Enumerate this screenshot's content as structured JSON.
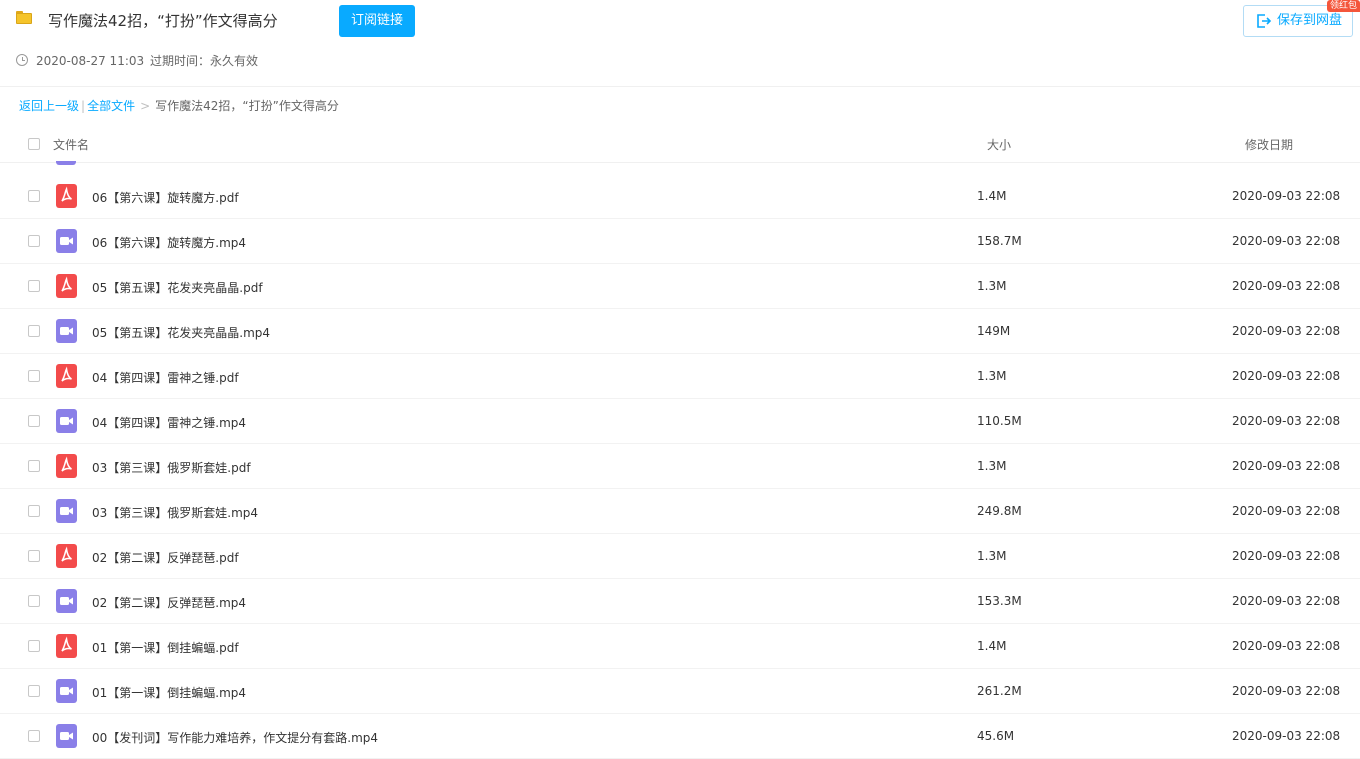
{
  "header": {
    "title": "写作魔法42招，“打扮”作文得高分",
    "subscribe_label": "订阅链接",
    "save_label": "保存到网盘",
    "red_badge": "领红包",
    "time": "2020-08-27 11:03",
    "expire_label": "过期时间：",
    "expire_value": "永久有效"
  },
  "breadcrumb": {
    "back": "返回上一级",
    "sep": "|",
    "all_files": "全部文件",
    "gt": ">",
    "current": "写作魔法42招，“打扮”作文得高分"
  },
  "columns": {
    "name": "文件名",
    "size": "大小",
    "date": "修改日期"
  },
  "colors": {
    "accent": "#09aaff",
    "pdf": "#f34b4b",
    "video": "#8a7fe8"
  },
  "files": [
    {
      "name": "06【第六课】旋转魔方.pdf",
      "size": "1.4M",
      "date": "2020-09-03 22:08",
      "icon": "pdf-icon"
    },
    {
      "name": "06【第六课】旋转魔方.mp4",
      "size": "158.7M",
      "date": "2020-09-03 22:08",
      "icon": "video-icon"
    },
    {
      "name": "05【第五课】花发夹亮晶晶.pdf",
      "size": "1.3M",
      "date": "2020-09-03 22:08",
      "icon": "pdf-icon"
    },
    {
      "name": "05【第五课】花发夹亮晶晶.mp4",
      "size": "149M",
      "date": "2020-09-03 22:08",
      "icon": "video-icon"
    },
    {
      "name": "04【第四课】雷神之锤.pdf",
      "size": "1.3M",
      "date": "2020-09-03 22:08",
      "icon": "pdf-icon"
    },
    {
      "name": "04【第四课】雷神之锤.mp4",
      "size": "110.5M",
      "date": "2020-09-03 22:08",
      "icon": "video-icon"
    },
    {
      "name": "03【第三课】俄罗斯套娃.pdf",
      "size": "1.3M",
      "date": "2020-09-03 22:08",
      "icon": "pdf-icon"
    },
    {
      "name": "03【第三课】俄罗斯套娃.mp4",
      "size": "249.8M",
      "date": "2020-09-03 22:08",
      "icon": "video-icon"
    },
    {
      "name": "02【第二课】反弹琵琶.pdf",
      "size": "1.3M",
      "date": "2020-09-03 22:08",
      "icon": "pdf-icon"
    },
    {
      "name": "02【第二课】反弹琵琶.mp4",
      "size": "153.3M",
      "date": "2020-09-03 22:08",
      "icon": "video-icon"
    },
    {
      "name": "01【第一课】倒挂蝙蝠.pdf",
      "size": "1.4M",
      "date": "2020-09-03 22:08",
      "icon": "pdf-icon"
    },
    {
      "name": "01【第一课】倒挂蝙蝠.mp4",
      "size": "261.2M",
      "date": "2020-09-03 22:08",
      "icon": "video-icon"
    },
    {
      "name": "00【发刊词】写作能力难培养，作文提分有套路.mp4",
      "size": "45.6M",
      "date": "2020-09-03 22:08",
      "icon": "video-icon"
    }
  ]
}
